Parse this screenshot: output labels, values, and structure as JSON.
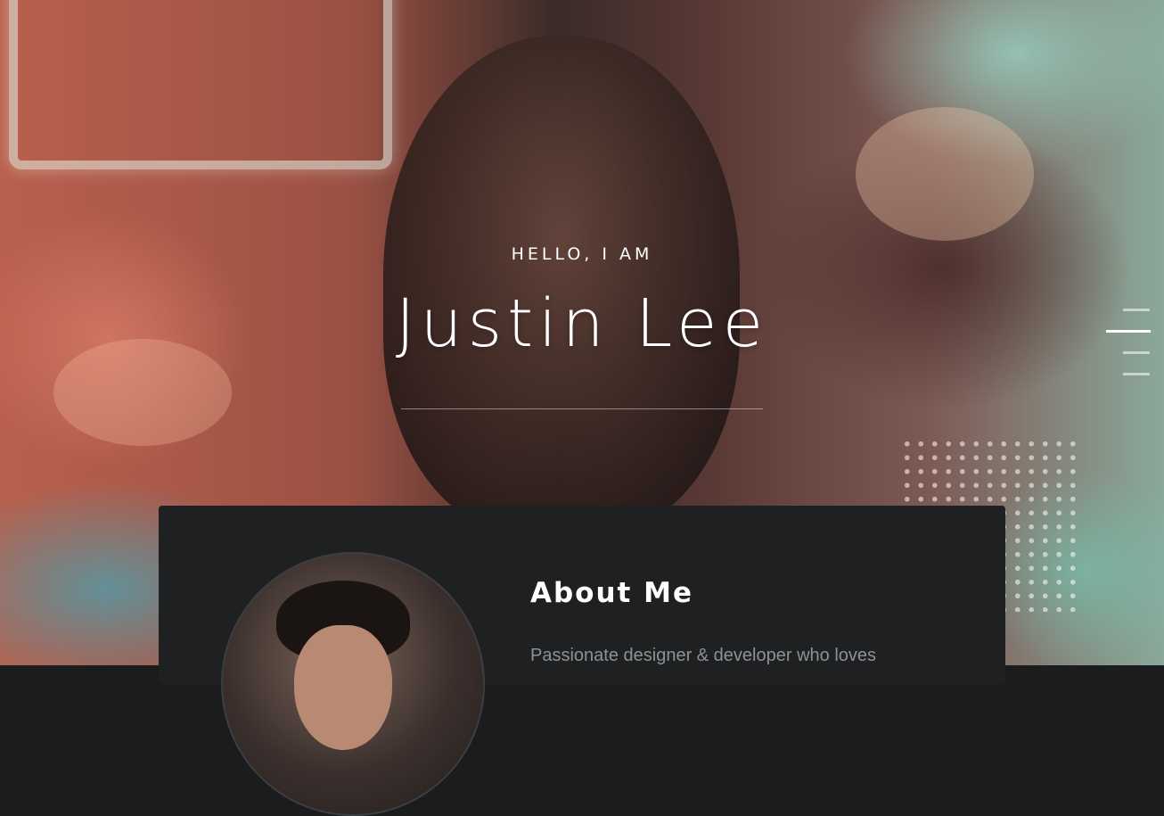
{
  "hero": {
    "greeting": "HELLO, I AM",
    "name": "Justin Lee"
  },
  "nav": {
    "menu_icon": "hamburger-menu-icon"
  },
  "about": {
    "title": "About Me",
    "text": "Passionate designer & developer who loves"
  },
  "colors": {
    "card_background": "#1f2022",
    "text_primary": "#ffffff",
    "text_muted": "#8e9193"
  }
}
